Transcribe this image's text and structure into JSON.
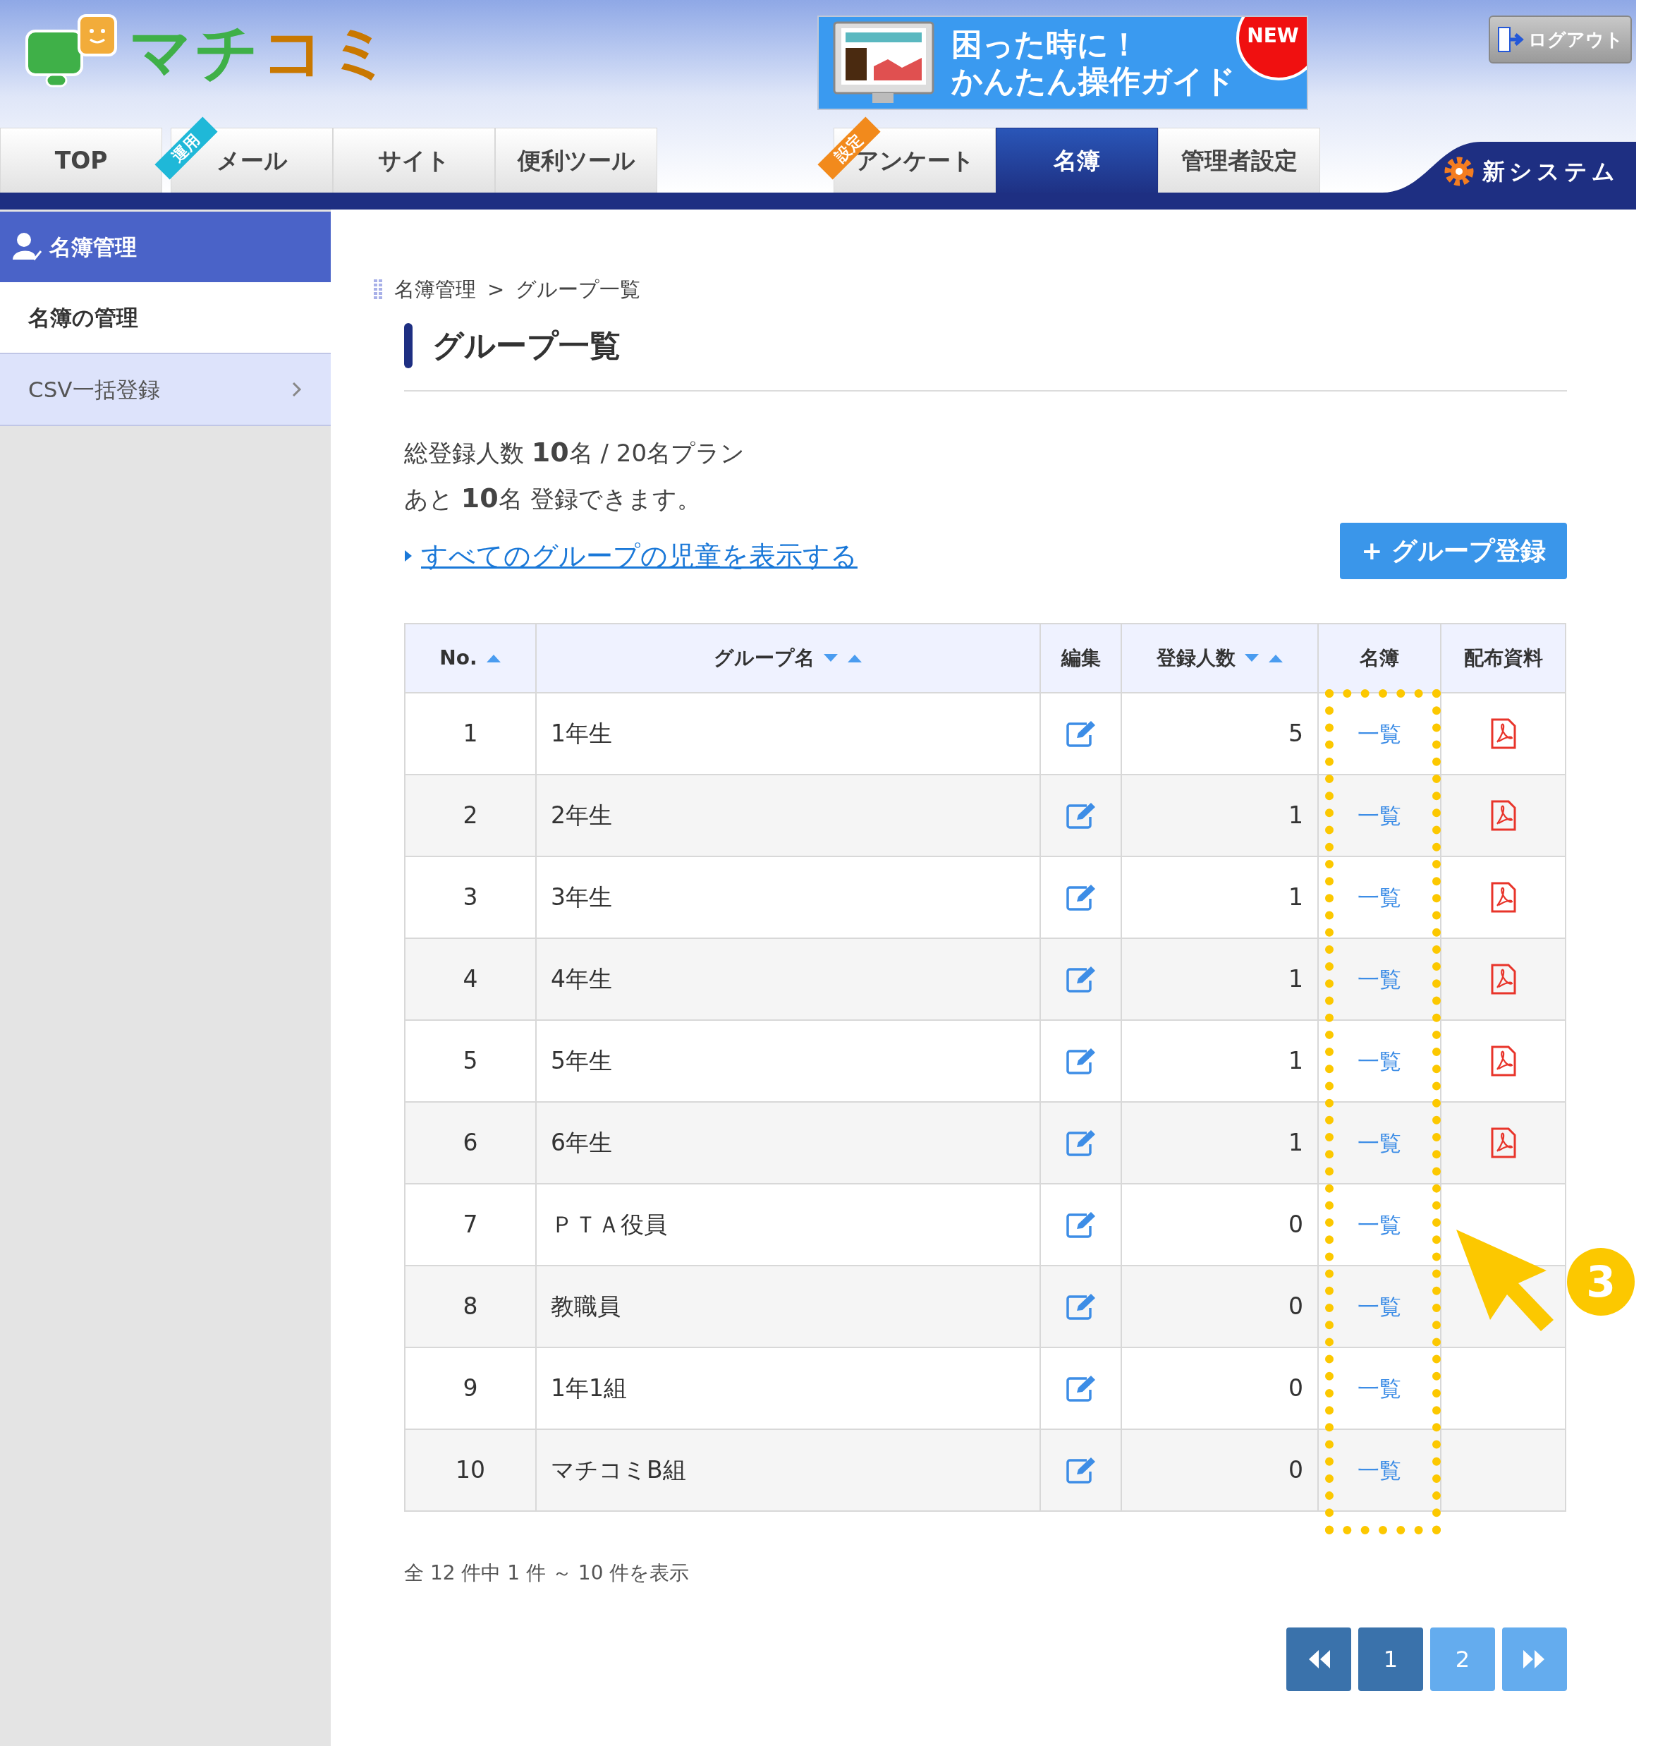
{
  "header": {
    "logo": "マチコミ",
    "guide_banner": {
      "line_1": "困った時に！",
      "line_2": "かんたん操作ガイド",
      "badge": "NEW"
    },
    "logout": "ログアウト",
    "new_system": "新システム"
  },
  "tabs": [
    {
      "label": "TOP",
      "selected": false
    },
    {
      "label": "メール",
      "selected": false,
      "ribbon": "運用",
      "color": "#1fb8d8"
    },
    {
      "label": "サイト",
      "selected": false
    },
    {
      "label": "便利ツール",
      "selected": false
    },
    {
      "label": "アンケート",
      "selected": false,
      "ribbon": "設定",
      "color": "#f28a1c"
    },
    {
      "label": "名簿",
      "selected": true
    },
    {
      "label": "管理者設定",
      "selected": false
    }
  ],
  "sidebar": {
    "title": "名簿管理",
    "items": [
      {
        "label": "名簿の管理",
        "selected": true,
        "chevron": false
      },
      {
        "label": "CSV一括登録",
        "selected": false,
        "chevron": true
      }
    ]
  },
  "breadcrumb": [
    "名簿管理",
    "グループ一覧"
  ],
  "breadcrumb_separator": ">",
  "page_title": "グループ一覧",
  "summary": [
    "総登録人数 **10**名 / 20名プラン",
    "あと **10**名 登録できます。"
  ],
  "show_all_link": "すべてのグループの児童を表示する",
  "add_group_button": "+ グループ登録",
  "table": {
    "columns": [
      {
        "label": "No.",
        "sort_down": false,
        "sort_up": true
      },
      {
        "label": "グループ名",
        "sort_down": true,
        "sort_up": true
      },
      {
        "label": "編集",
        "sort_down": false,
        "sort_up": false
      },
      {
        "label": "登録人数",
        "sort_down": true,
        "sort_up": true
      },
      {
        "label": "名簿",
        "sort_down": false,
        "sort_up": false
      },
      {
        "label": "配布資料",
        "sort_down": false,
        "sort_up": false
      }
    ],
    "rows": [
      {
        "no": "1",
        "name": "1年生",
        "count": "5",
        "roster": "一覧",
        "handout": true
      },
      {
        "no": "2",
        "name": "2年生",
        "count": "1",
        "roster": "一覧",
        "handout": true
      },
      {
        "no": "3",
        "name": "3年生",
        "count": "1",
        "roster": "一覧",
        "handout": true
      },
      {
        "no": "4",
        "name": "4年生",
        "count": "1",
        "roster": "一覧",
        "handout": true
      },
      {
        "no": "5",
        "name": "5年生",
        "count": "1",
        "roster": "一覧",
        "handout": true
      },
      {
        "no": "6",
        "name": "6年生",
        "count": "1",
        "roster": "一覧",
        "handout": true
      },
      {
        "no": "7",
        "name": "ＰＴＡ役員",
        "count": "0",
        "roster": "一覧",
        "handout": false
      },
      {
        "no": "8",
        "name": "教職員",
        "count": "0",
        "roster": "一覧",
        "handout": false
      },
      {
        "no": "9",
        "name": "1年1組",
        "count": "0",
        "roster": "一覧",
        "handout": false
      },
      {
        "no": "10",
        "name": "マチコミB組",
        "count": "0",
        "roster": "一覧",
        "handout": false
      }
    ]
  },
  "result_count": "全 12 件中 1 件 ～ 10 件を表示",
  "pagination": {
    "first_disabled": true,
    "next_disabled": false,
    "pages": [
      {
        "label": "1",
        "selected": true
      },
      {
        "label": "2",
        "selected": false
      }
    ]
  },
  "annotation": {
    "number": "3"
  }
}
